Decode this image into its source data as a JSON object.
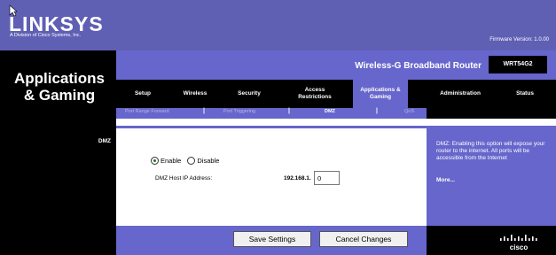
{
  "brand": {
    "logo_text": "LINKSYS",
    "logo_sub": "A Division of Cisco Systems, Inc.",
    "firmware": "Firmware Version: 1.0.00",
    "footer_logo": "cisco"
  },
  "header": {
    "page_title": "Applications & Gaming",
    "product_name": "Wireless-G Broadband Router",
    "model": "WRT54G2"
  },
  "tabs": [
    {
      "label": "Setup"
    },
    {
      "label": "Wireless"
    },
    {
      "label": "Security"
    },
    {
      "label": "Access Restrictions"
    },
    {
      "label": "Applications & Gaming"
    },
    {
      "label": "Administration"
    },
    {
      "label": "Status"
    }
  ],
  "subtabs": [
    {
      "label": "Port Range Forward"
    },
    {
      "label": "Port Triggering"
    },
    {
      "label": "DMZ"
    },
    {
      "label": "QoS"
    }
  ],
  "section": {
    "title": "DMZ"
  },
  "dmz": {
    "enable_label": "Enable",
    "disable_label": "Disable",
    "selected": "Enable",
    "host_label": "DMZ Host IP Address:",
    "host_prefix": "192.168.1.",
    "host_value": "0"
  },
  "help": {
    "text": "DMZ: Enabling this option will expose your router to the internet. All ports will be accessible from the Internet",
    "more": "More..."
  },
  "actions": {
    "save": "Save Settings",
    "cancel": "Cancel Changes"
  },
  "colors": {
    "accent": "#6666cc",
    "banner": "#5f5fb4",
    "dark": "#000000"
  }
}
